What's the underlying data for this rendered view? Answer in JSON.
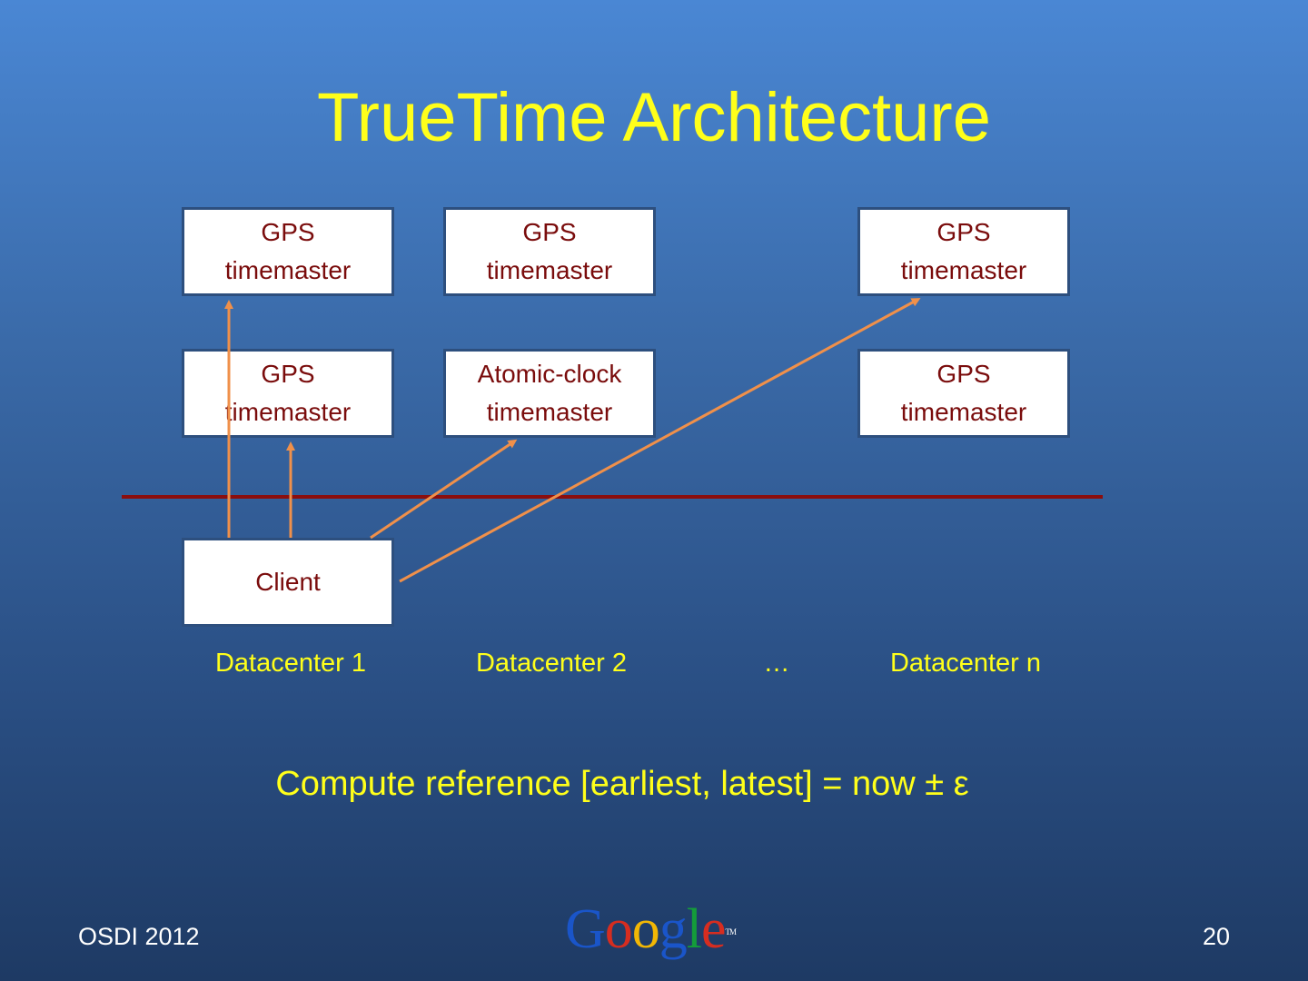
{
  "slide": {
    "title": "TrueTime Architecture",
    "footer_left": "OSDI 2012",
    "page_number": "20",
    "logo": {
      "letters": [
        "G",
        "o",
        "o",
        "g",
        "l",
        "e"
      ],
      "colors": [
        "#1a55c9",
        "#d62d20",
        "#f2b705",
        "#1a55c9",
        "#149c3a",
        "#d62d20"
      ],
      "trademark": "TM"
    }
  },
  "boxes": {
    "dc1_top": "GPS\ntimemaster",
    "dc2_top": "GPS\ntimemaster",
    "dcn_top": "GPS\ntimemaster",
    "dc1_mid": "GPS\ntimemaster",
    "dc2_mid": "Atomic-clock\ntimemaster",
    "dcn_mid": "GPS\ntimemaster",
    "client": "Client"
  },
  "labels": {
    "dc1": "Datacenter 1",
    "dc2": "Datacenter 2",
    "ellipsis": "…",
    "dcn": "Datacenter n"
  },
  "formula": "Compute reference [earliest, latest] = now ± ε",
  "colors": {
    "title": "#ffff1a",
    "box_text": "#7a0c0c",
    "arrow": "#f0904a",
    "divider": "#8b0e0e"
  }
}
